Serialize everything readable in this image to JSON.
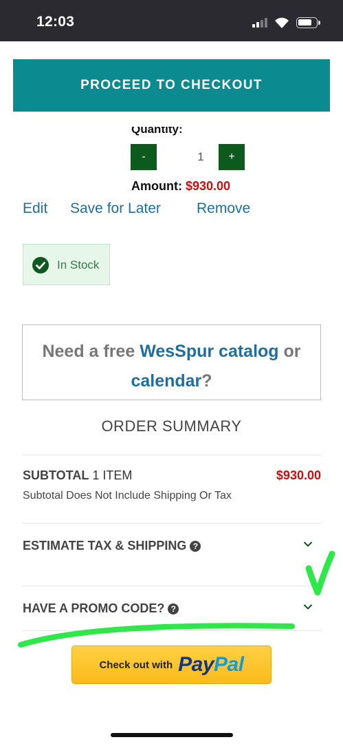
{
  "status_bar": {
    "time": "12:03",
    "icons": [
      "cellular-signal-icon",
      "wifi-icon",
      "battery-icon"
    ]
  },
  "checkout": {
    "button_label": "PROCEED TO CHECKOUT"
  },
  "cart_item": {
    "quantity_label": "Quantity:",
    "decrement_label": "-",
    "quantity_value": "1",
    "increment_label": "+",
    "amount_label": "Amount:",
    "amount_value": "$930.00",
    "links": {
      "edit": "Edit",
      "save_for_later": "Save for Later",
      "remove": "Remove"
    },
    "stock_status": "In Stock"
  },
  "catalog_promo": {
    "prefix": "Need a free ",
    "catalog_link": "WesSpur catalog",
    "middle": " or",
    "calendar_link": "calendar",
    "suffix": "?"
  },
  "order_summary": {
    "title": "ORDER SUMMARY",
    "subtotal_label": "SUBTOTAL",
    "item_count": "1 ITEM",
    "subtotal_value": "$930.00",
    "subtotal_note": "Subtotal Does Not Include Shipping Or Tax",
    "estimate_label": "ESTIMATE TAX & SHIPPING",
    "promo_label": "HAVE A PROMO CODE?"
  },
  "paypal": {
    "prefix": "Check out with",
    "logo_pay": "Pay",
    "logo_pal": "Pal"
  },
  "colors": {
    "status_bar": "#2a2a30",
    "checkout_button": "#0b8a8f",
    "quantity_button": "#0c5a1e",
    "price_red": "#cc1010",
    "link_blue": "#1e6fa0",
    "stock_background": "#e6f7ea",
    "annotation_green": "#2ee84a",
    "paypal_yellow": "#fcc22e",
    "paypal_dark_blue": "#14367f",
    "paypal_light_blue": "#169bd7"
  }
}
